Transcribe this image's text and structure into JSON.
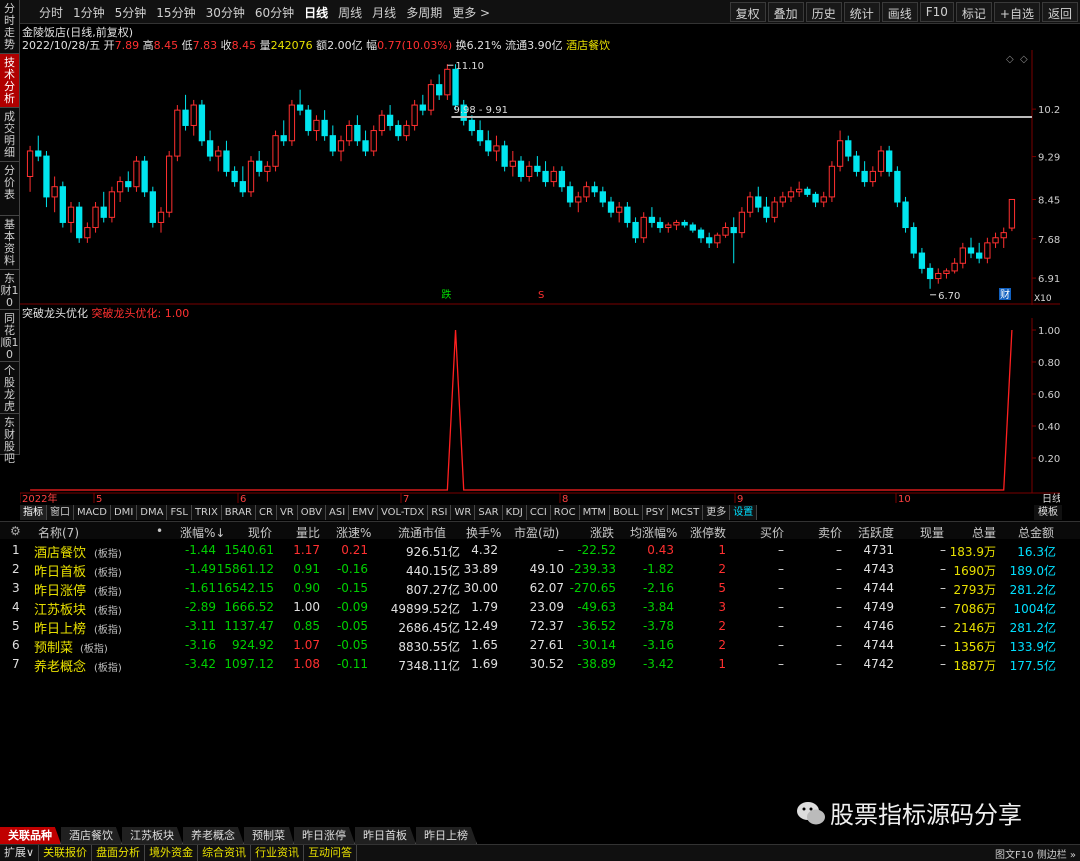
{
  "toolbar": {
    "periods": [
      "分时",
      "1分钟",
      "5分钟",
      "15分钟",
      "30分钟",
      "60分钟",
      "日线",
      "周线",
      "月线",
      "多周期",
      "更多 >"
    ],
    "active_period": "日线",
    "right_buttons": [
      "复权",
      "叠加",
      "历史",
      "统计",
      "画线",
      "F10",
      "标记",
      "+自选",
      "返回"
    ]
  },
  "left_tabs": [
    "分时走势",
    "技术分析",
    "成交明细",
    "分价表",
    "基本资料",
    "东财10",
    "同花顺10",
    "个股龙虎",
    "东财股吧"
  ],
  "left_active": "技术分析",
  "stock": {
    "name_line": "金陵饭店(日线,前复权)",
    "date": "2022/10/28/五",
    "open_label": "开",
    "open": "7.89",
    "high_label": "高",
    "high": "8.45",
    "low_label": "低",
    "low": "7.83",
    "close_label": "收",
    "close": "8.45",
    "vol_label": "量",
    "vol": "242076",
    "amount_label": "额",
    "amount": "2.00亿",
    "change_label": "幅",
    "change": "0.77(10.03%)",
    "turnover_label": "换",
    "turnover": "6.21%",
    "float_label": "流通",
    "float": "3.90亿",
    "sector": "酒店餐饮"
  },
  "price_chart": {
    "y_ticks": [
      "10.22",
      "9.29",
      "8.45",
      "7.68",
      "6.91"
    ],
    "high_label": "11.10",
    "low_label": "6.70",
    "range_label": "9.98 - 9.91",
    "marker_up": "跌",
    "marker_s": "S",
    "marker_cai": "财",
    "x10": "X10"
  },
  "indicator": {
    "name": "突破龙头优化",
    "value_label": "突破龙头优化: 1.00",
    "y_ticks": [
      "1.00",
      "0.80",
      "0.60",
      "0.40",
      "0.20"
    ],
    "x_labels": [
      "2022年",
      "5",
      "6",
      "7",
      "8",
      "9",
      "10"
    ],
    "right_label": "日线"
  },
  "ind_tabs": [
    "指标",
    "窗口",
    "MACD",
    "DMI",
    "DMA",
    "FSL",
    "TRIX",
    "BRAR",
    "CR",
    "VR",
    "OBV",
    "ASI",
    "EMV",
    "VOL-TDX",
    "RSI",
    "WR",
    "SAR",
    "KDJ",
    "CCI",
    "ROC",
    "MTM",
    "BOLL",
    "PSY",
    "MCST",
    "更多",
    "设置"
  ],
  "ind_tabs_right": "模板",
  "table": {
    "headers": [
      "名称(7)",
      "•",
      "涨幅%↓",
      "现价",
      "量比",
      "涨速%",
      "流通市值",
      "换手%",
      "市盈(动)",
      "涨跌",
      "均涨幅%",
      "涨停数",
      "买价",
      "卖价",
      "活跃度",
      "现量",
      "总量",
      "总金额"
    ],
    "rows": [
      {
        "idx": "1",
        "name": "酒店餐饮",
        "tag": "(板指)",
        "chg": "-1.44",
        "price": "1540.61",
        "vr": "1.17",
        "spd": "0.21",
        "mcap": "926.51亿",
        "turn": "4.32",
        "pe": "–",
        "diff": "-22.52",
        "avg": "0.43",
        "limit": "1",
        "bid": "–",
        "ask": "–",
        "act": "4731",
        "cur": "–",
        "vol": "183.9万",
        "amt": "16.3亿"
      },
      {
        "idx": "2",
        "name": "昨日首板",
        "tag": "(板指)",
        "chg": "-1.49",
        "price": "15861.12",
        "vr": "0.91",
        "spd": "-0.16",
        "mcap": "440.15亿",
        "turn": "33.89",
        "pe": "49.10",
        "diff": "-239.33",
        "avg": "-1.82",
        "limit": "2",
        "bid": "–",
        "ask": "–",
        "act": "4743",
        "cur": "–",
        "vol": "1690万",
        "amt": "189.0亿"
      },
      {
        "idx": "3",
        "name": "昨日涨停",
        "tag": "(板指)",
        "chg": "-1.61",
        "price": "16542.15",
        "vr": "0.90",
        "spd": "-0.15",
        "mcap": "807.27亿",
        "turn": "30.00",
        "pe": "62.07",
        "diff": "-270.65",
        "avg": "-2.16",
        "limit": "5",
        "bid": "–",
        "ask": "–",
        "act": "4744",
        "cur": "–",
        "vol": "2793万",
        "amt": "281.2亿"
      },
      {
        "idx": "4",
        "name": "江苏板块",
        "tag": "(板指)",
        "chg": "-2.89",
        "price": "1666.52",
        "vr": "1.00",
        "spd": "-0.09",
        "mcap": "49899.52亿",
        "turn": "1.79",
        "pe": "23.09",
        "diff": "-49.63",
        "avg": "-3.84",
        "limit": "3",
        "bid": "–",
        "ask": "–",
        "act": "4749",
        "cur": "–",
        "vol": "7086万",
        "amt": "1004亿"
      },
      {
        "idx": "5",
        "name": "昨日上榜",
        "tag": "(板指)",
        "chg": "-3.11",
        "price": "1137.47",
        "vr": "0.85",
        "spd": "-0.05",
        "mcap": "2686.45亿",
        "turn": "12.49",
        "pe": "72.37",
        "diff": "-36.52",
        "avg": "-3.78",
        "limit": "2",
        "bid": "–",
        "ask": "–",
        "act": "4746",
        "cur": "–",
        "vol": "2146万",
        "amt": "281.2亿"
      },
      {
        "idx": "6",
        "name": "预制菜",
        "tag": "(板指)",
        "chg": "-3.16",
        "price": "924.92",
        "vr": "1.07",
        "spd": "-0.05",
        "mcap": "8830.55亿",
        "turn": "1.65",
        "pe": "27.61",
        "diff": "-30.14",
        "avg": "-3.16",
        "limit": "2",
        "bid": "–",
        "ask": "–",
        "act": "4744",
        "cur": "–",
        "vol": "1356万",
        "amt": "133.9亿"
      },
      {
        "idx": "7",
        "name": "养老概念",
        "tag": "(板指)",
        "chg": "-3.42",
        "price": "1097.12",
        "vr": "1.08",
        "spd": "-0.11",
        "mcap": "7348.11亿",
        "turn": "1.69",
        "pe": "30.52",
        "diff": "-38.89",
        "avg": "-3.42",
        "limit": "1",
        "bid": "–",
        "ask": "–",
        "act": "4742",
        "cur": "–",
        "vol": "1887万",
        "amt": "177.5亿"
      }
    ]
  },
  "bottom_tabs": [
    "关联品种",
    "酒店餐饮",
    "江苏板块",
    "养老概念",
    "预制菜",
    "昨日涨停",
    "昨日首板",
    "昨日上榜"
  ],
  "status": [
    "扩展∨",
    "关联报价",
    "盘面分析",
    "境外资金",
    "综合资讯",
    "行业资讯",
    "互动问答"
  ],
  "status_right": "图文F10  侧边栏 »",
  "watermark": "股票指标源码分享",
  "colors": {
    "up": "#ff3030",
    "down": "#00e5ee",
    "accent": "#b00000"
  },
  "chart_data": {
    "type": "candlestick",
    "note_series": "daily OHLC, 2022 Apr–Oct",
    "candles": [
      [
        8.9,
        9.5,
        8.6,
        9.4
      ],
      [
        9.4,
        9.7,
        9.2,
        9.3
      ],
      [
        9.3,
        9.4,
        8.3,
        8.5
      ],
      [
        8.5,
        8.9,
        8.2,
        8.7
      ],
      [
        8.7,
        8.8,
        7.9,
        8.0
      ],
      [
        8.0,
        8.4,
        7.8,
        8.3
      ],
      [
        8.3,
        8.4,
        7.6,
        7.7
      ],
      [
        7.7,
        8.0,
        7.6,
        7.9
      ],
      [
        7.9,
        8.4,
        7.8,
        8.3
      ],
      [
        8.3,
        8.6,
        8.0,
        8.1
      ],
      [
        8.1,
        8.7,
        8.0,
        8.6
      ],
      [
        8.6,
        8.9,
        8.4,
        8.8
      ],
      [
        8.8,
        9.0,
        8.6,
        8.7
      ],
      [
        8.7,
        9.3,
        8.6,
        9.2
      ],
      [
        9.2,
        9.3,
        8.5,
        8.6
      ],
      [
        8.6,
        8.7,
        7.9,
        8.0
      ],
      [
        8.0,
        8.3,
        7.8,
        8.2
      ],
      [
        8.2,
        9.4,
        8.1,
        9.3
      ],
      [
        9.3,
        10.3,
        9.2,
        10.2
      ],
      [
        10.2,
        10.5,
        9.8,
        9.9
      ],
      [
        9.9,
        10.4,
        9.7,
        10.3
      ],
      [
        10.3,
        10.4,
        9.5,
        9.6
      ],
      [
        9.6,
        9.8,
        9.2,
        9.3
      ],
      [
        9.3,
        9.5,
        9.0,
        9.4
      ],
      [
        9.4,
        9.6,
        8.9,
        9.0
      ],
      [
        9.0,
        9.1,
        8.7,
        8.8
      ],
      [
        8.8,
        9.1,
        8.5,
        8.6
      ],
      [
        8.6,
        9.3,
        8.5,
        9.2
      ],
      [
        9.2,
        9.4,
        8.9,
        9.0
      ],
      [
        9.0,
        9.2,
        8.8,
        9.1
      ],
      [
        9.1,
        9.8,
        9.0,
        9.7
      ],
      [
        9.7,
        10.0,
        9.5,
        9.6
      ],
      [
        9.6,
        10.4,
        9.5,
        10.3
      ],
      [
        10.3,
        10.6,
        10.1,
        10.2
      ],
      [
        10.2,
        10.3,
        9.7,
        9.8
      ],
      [
        9.8,
        10.1,
        9.6,
        10.0
      ],
      [
        10.0,
        10.2,
        9.6,
        9.7
      ],
      [
        9.7,
        9.9,
        9.3,
        9.4
      ],
      [
        9.4,
        9.7,
        9.2,
        9.6
      ],
      [
        9.6,
        10.0,
        9.5,
        9.9
      ],
      [
        9.9,
        10.1,
        9.5,
        9.6
      ],
      [
        9.6,
        9.8,
        9.3,
        9.4
      ],
      [
        9.4,
        9.9,
        9.3,
        9.8
      ],
      [
        9.8,
        10.2,
        9.7,
        10.1
      ],
      [
        10.1,
        10.3,
        9.8,
        9.9
      ],
      [
        9.9,
        10.0,
        9.6,
        9.7
      ],
      [
        9.7,
        10.0,
        9.6,
        9.9
      ],
      [
        9.9,
        10.4,
        9.8,
        10.3
      ],
      [
        10.3,
        10.5,
        10.1,
        10.2
      ],
      [
        10.2,
        10.8,
        10.1,
        10.7
      ],
      [
        10.7,
        10.9,
        10.4,
        10.5
      ],
      [
        10.5,
        11.1,
        10.4,
        11.0
      ],
      [
        11.0,
        11.1,
        10.2,
        10.3
      ],
      [
        10.3,
        10.4,
        9.9,
        10.0
      ],
      [
        10.0,
        10.1,
        9.7,
        9.8
      ],
      [
        9.8,
        10.0,
        9.5,
        9.6
      ],
      [
        9.6,
        9.8,
        9.3,
        9.4
      ],
      [
        9.4,
        9.7,
        9.2,
        9.5
      ],
      [
        9.5,
        9.6,
        9.0,
        9.1
      ],
      [
        9.1,
        9.4,
        8.9,
        9.2
      ],
      [
        9.2,
        9.3,
        8.8,
        8.9
      ],
      [
        8.9,
        9.2,
        8.8,
        9.1
      ],
      [
        9.1,
        9.3,
        8.9,
        9.0
      ],
      [
        9.0,
        9.2,
        8.7,
        8.8
      ],
      [
        8.8,
        9.1,
        8.7,
        9.0
      ],
      [
        9.0,
        9.1,
        8.6,
        8.7
      ],
      [
        8.7,
        8.8,
        8.3,
        8.4
      ],
      [
        8.4,
        8.6,
        8.2,
        8.5
      ],
      [
        8.5,
        8.8,
        8.4,
        8.7
      ],
      [
        8.7,
        8.8,
        8.5,
        8.6
      ],
      [
        8.6,
        8.7,
        8.3,
        8.4
      ],
      [
        8.4,
        8.5,
        8.1,
        8.2
      ],
      [
        8.2,
        8.4,
        8.0,
        8.3
      ],
      [
        8.3,
        8.4,
        7.9,
        8.0
      ],
      [
        8.0,
        8.1,
        7.6,
        7.7
      ],
      [
        7.7,
        8.2,
        7.6,
        8.1
      ],
      [
        8.1,
        8.3,
        7.9,
        8.0
      ],
      [
        8.0,
        8.1,
        7.8,
        7.9
      ],
      [
        7.9,
        8.0,
        7.8,
        7.95
      ],
      [
        7.95,
        8.05,
        7.85,
        8.0
      ],
      [
        8.0,
        8.05,
        7.9,
        7.95
      ],
      [
        7.95,
        8.0,
        7.8,
        7.85
      ],
      [
        7.85,
        7.9,
        7.6,
        7.7
      ],
      [
        7.7,
        7.8,
        7.5,
        7.6
      ],
      [
        7.6,
        7.8,
        7.5,
        7.75
      ],
      [
        7.75,
        8.0,
        7.7,
        7.9
      ],
      [
        7.9,
        8.1,
        7.2,
        7.8
      ],
      [
        7.8,
        8.3,
        7.7,
        8.2
      ],
      [
        8.2,
        8.6,
        8.1,
        8.5
      ],
      [
        8.5,
        8.7,
        8.2,
        8.3
      ],
      [
        8.3,
        8.5,
        8.0,
        8.1
      ],
      [
        8.1,
        8.5,
        8.0,
        8.4
      ],
      [
        8.4,
        8.6,
        8.3,
        8.5
      ],
      [
        8.5,
        8.7,
        8.4,
        8.6
      ],
      [
        8.6,
        8.8,
        8.5,
        8.65
      ],
      [
        8.65,
        8.7,
        8.5,
        8.55
      ],
      [
        8.55,
        8.6,
        8.3,
        8.4
      ],
      [
        8.4,
        8.6,
        8.3,
        8.5
      ],
      [
        8.5,
        9.2,
        8.4,
        9.1
      ],
      [
        9.1,
        9.8,
        9.0,
        9.6
      ],
      [
        9.6,
        9.7,
        9.2,
        9.3
      ],
      [
        9.3,
        9.4,
        8.9,
        9.0
      ],
      [
        9.0,
        9.2,
        8.7,
        8.8
      ],
      [
        8.8,
        9.1,
        8.7,
        9.0
      ],
      [
        9.0,
        9.5,
        8.9,
        9.4
      ],
      [
        9.4,
        9.5,
        8.9,
        9.0
      ],
      [
        9.0,
        9.1,
        8.3,
        8.4
      ],
      [
        8.4,
        8.5,
        7.8,
        7.9
      ],
      [
        7.9,
        8.0,
        7.3,
        7.4
      ],
      [
        7.4,
        7.5,
        7.0,
        7.1
      ],
      [
        7.1,
        7.2,
        6.7,
        6.9
      ],
      [
        6.9,
        7.1,
        6.8,
        7.0
      ],
      [
        7.0,
        7.1,
        6.9,
        7.05
      ],
      [
        7.05,
        7.3,
        7.0,
        7.2
      ],
      [
        7.2,
        7.6,
        7.1,
        7.5
      ],
      [
        7.5,
        7.7,
        7.3,
        7.4
      ],
      [
        7.4,
        7.6,
        7.2,
        7.3
      ],
      [
        7.3,
        7.7,
        7.2,
        7.6
      ],
      [
        7.6,
        7.8,
        7.5,
        7.7
      ],
      [
        7.7,
        7.9,
        7.5,
        7.8
      ],
      [
        7.89,
        8.45,
        7.83,
        8.45
      ]
    ],
    "indicator_series": {
      "name": "突破龙头优化",
      "spikes_at": [
        52,
        120
      ],
      "ylim": [
        0,
        1.05
      ]
    }
  }
}
